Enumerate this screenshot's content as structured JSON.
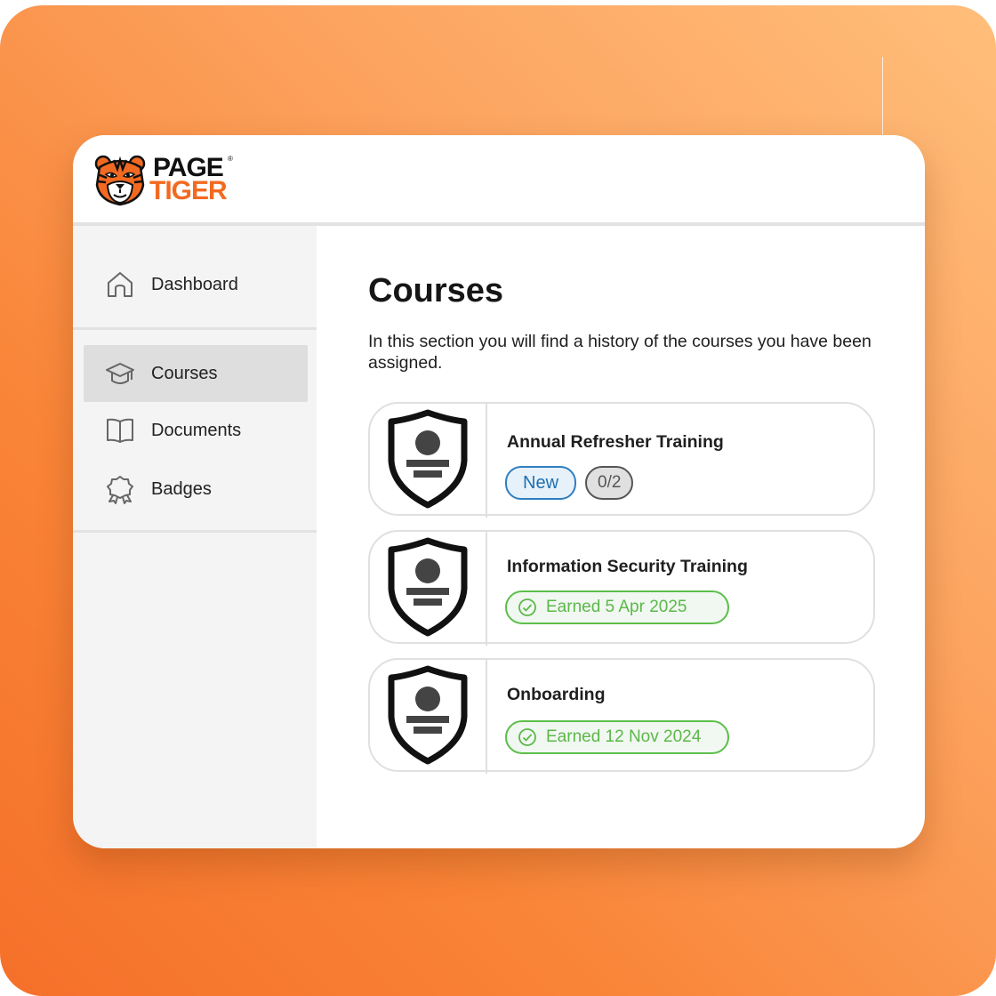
{
  "brand": {
    "line1": "PAGE",
    "line2": "TIGER",
    "reg": "®",
    "accent_color": "#f26a21"
  },
  "sidebar": {
    "items": [
      {
        "label": "Dashboard",
        "icon": "home-icon",
        "active": false
      },
      {
        "label": "Courses",
        "icon": "graduation-cap-icon",
        "active": true
      },
      {
        "label": "Documents",
        "icon": "book-icon",
        "active": false
      },
      {
        "label": "Badges",
        "icon": "award-icon",
        "active": false
      }
    ]
  },
  "main": {
    "title": "Courses",
    "description": "In this section you will find a history of the courses you have been assigned.",
    "courses": [
      {
        "title": "Annual Refresher Training",
        "status": "New",
        "progress": "0/2",
        "badge_icon": "shield-badge-icon"
      },
      {
        "title": "Information Security Training",
        "status": "Earned 5 Apr 2025",
        "badge_icon": "shield-badge-icon"
      },
      {
        "title": "Onboarding",
        "status": "Earned 12 Nov 2024",
        "badge_icon": "shield-badge-icon"
      }
    ]
  },
  "colors": {
    "new_pill": "#2f7fc1",
    "earned_pill": "#5cbf4a",
    "count_pill": "#555555",
    "background_gradient_start": "#ffbe7a",
    "background_gradient_end": "#f5702a"
  }
}
